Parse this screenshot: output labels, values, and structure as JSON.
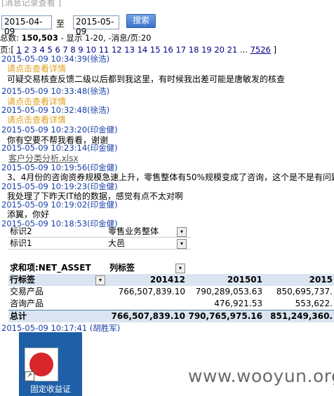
{
  "top_bar": {
    "title": "[消息记录查看 ]"
  },
  "search": {
    "start_date": "2015-04-09",
    "to_label": "至",
    "end_date": "2015-05-09",
    "button_label": "搜索"
  },
  "summary": {
    "total_label": "总数:",
    "total": "150,503",
    "range_text": " - 显示 1-20,",
    "per_page_text": " -消息/页:20"
  },
  "pager": {
    "label": "页:[",
    "pages": [
      "1",
      "2",
      "3",
      "4",
      "5",
      "6",
      "7",
      "8",
      "9",
      "10",
      "11",
      "12",
      "13",
      "14",
      "15",
      "16",
      "17",
      "18",
      "19",
      "20",
      "21"
    ],
    "ellipsis": "...",
    "last_page": "7526",
    "close": "]"
  },
  "messages": [
    {
      "time": "2015-05-09 10:34:39",
      "sender": "徐浩"
    },
    {
      "detail": "请点击查看详情"
    },
    {
      "text": "可疑交易核查反馈二级以后都到我这里，有时候我出差可能是唐敏发的核查"
    },
    {
      "time": "2015-05-09 10:33:48",
      "sender": "徐浩"
    },
    {
      "detail": "请点击查看详情"
    },
    {
      "time": "2015-05-09 10:32:48",
      "sender": "徐浩"
    },
    {
      "detail": "请点击查看详情"
    },
    {
      "time": "2015-05-09 10:23:20",
      "sender": "印金健"
    },
    {
      "text": "你有空要不帮我看看，谢谢"
    },
    {
      "time": "2015-05-09 10:23:14",
      "sender": "印金健"
    },
    {
      "file": "客户分类分析.xlsx"
    },
    {
      "time": "2015-05-09 10:19:56",
      "sender": "印金健"
    },
    {
      "text": "3、4月份的咨询资券规模急速上升，零售整体有50%规模变成了咨询，这个是不是有问题啊"
    },
    {
      "time": "2015-05-09 10:19:23",
      "sender": "印金健"
    },
    {
      "text": "我处理了下昨天IT给的数据，感觉有点不太对啊"
    },
    {
      "time": "2015-05-09 10:19:02",
      "sender": "印金健"
    },
    {
      "text": "添翼，你好"
    },
    {
      "time": "2015-05-09 10:18:53",
      "sender": "印金健"
    }
  ],
  "pivot": {
    "filters": [
      {
        "field": "标识2",
        "value": "零售业务整体"
      },
      {
        "field": "标识1",
        "value": "大邑"
      }
    ],
    "value_label": "求和项:NET_ASSET",
    "col_label": "列标签",
    "row_label": "行标签",
    "columns": [
      "201412",
      "201501",
      "2015"
    ],
    "rows": [
      {
        "name": "交易产品",
        "values": [
          "766,507,839.10",
          "790,289,053.63",
          "850,695,737."
        ]
      },
      {
        "name": "咨询产品",
        "values": [
          "",
          "476,921.53",
          "553,622."
        ]
      }
    ],
    "total": {
      "name": "总计",
      "values": [
        "766,507,839.10",
        "790,765,975.16",
        "851,249,360."
      ]
    }
  },
  "last_message": {
    "time": "2015-05-09 10:17:41",
    "sender": "胡胜军"
  },
  "desktop_icon": {
    "label": "固定收益证"
  },
  "watermark": "www.wooyun.org"
}
